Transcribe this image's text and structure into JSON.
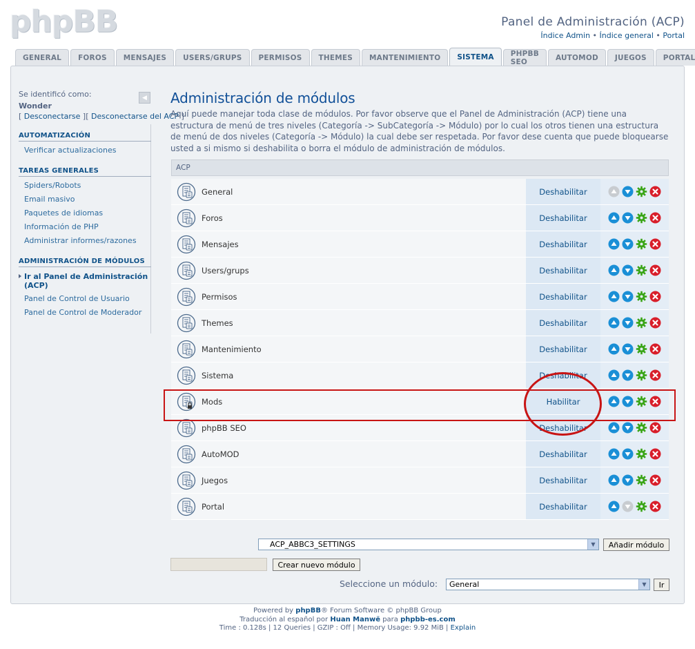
{
  "logo": {
    "text": "phpBB"
  },
  "header": {
    "title": "Panel de Administración (ACP)",
    "links": [
      "Índice Admin",
      "Índice general",
      "Portal"
    ],
    "separator": " • "
  },
  "tabs": [
    {
      "label": "GENERAL",
      "active": false
    },
    {
      "label": "FOROS",
      "active": false
    },
    {
      "label": "MENSAJES",
      "active": false
    },
    {
      "label": "USERS/GRUPS",
      "active": false
    },
    {
      "label": "PERMISOS",
      "active": false
    },
    {
      "label": "THEMES",
      "active": false
    },
    {
      "label": "MANTENIMIENTO",
      "active": false
    },
    {
      "label": "SISTEMA",
      "active": true
    },
    {
      "label": "PHPBB SEO",
      "active": false
    },
    {
      "label": "AUTOMOD",
      "active": false
    },
    {
      "label": "JUEGOS",
      "active": false
    },
    {
      "label": "PORTAL",
      "active": false
    }
  ],
  "sidebar": {
    "identified_as": "Se identificó como:",
    "username": "Wonder",
    "logout_open": "[ ",
    "logout_1": "Desconectarse",
    "logout_mid": " ][ ",
    "logout_2": "Desconectarse del ACP",
    "logout_close": " ]",
    "sections": [
      {
        "heading": "AUTOMATIZACIÓN",
        "items": [
          "Verificar actualizaciones"
        ]
      },
      {
        "heading": "TAREAS GENERALES",
        "items": [
          "Spiders/Robots",
          "Email masivo",
          "Paquetes de idiomas",
          "Información de PHP",
          "Administrar informes/razones"
        ]
      },
      {
        "heading": "ADMINISTRACIÓN DE MÓDULOS",
        "active_item": "Ir al Panel de Administración (ACP)",
        "items": [
          "Panel de Control de Usuario",
          "Panel de Control de Moderador"
        ]
      }
    ]
  },
  "main": {
    "title": "Administración de módulos",
    "description": "Aquí puede manejar toda clase de módulos. Por favor observe que el Panel de Administración (ACP) tiene una estructura de menú de tres niveles (Categoría -> SubCategoría -> Módulo) por lo cual los otros tienen una estructura de menú de dos niveles (Categoría -> Módulo) la cual debe ser respetada. Por favor dese cuenta que puede bloquearse usted a si mismo si deshabilita o borra el módulo de administración de módulos.",
    "table_header": "ACP",
    "modules": [
      {
        "name": "General",
        "action": "Deshabilitar",
        "up_enabled": false,
        "down_enabled": true,
        "locked": false
      },
      {
        "name": "Foros",
        "action": "Deshabilitar",
        "up_enabled": true,
        "down_enabled": true,
        "locked": false
      },
      {
        "name": "Mensajes",
        "action": "Deshabilitar",
        "up_enabled": true,
        "down_enabled": true,
        "locked": false
      },
      {
        "name": "Users/grups",
        "action": "Deshabilitar",
        "up_enabled": true,
        "down_enabled": true,
        "locked": false
      },
      {
        "name": "Permisos",
        "action": "Deshabilitar",
        "up_enabled": true,
        "down_enabled": true,
        "locked": false
      },
      {
        "name": "Themes",
        "action": "Deshabilitar",
        "up_enabled": true,
        "down_enabled": true,
        "locked": false
      },
      {
        "name": "Mantenimiento",
        "action": "Deshabilitar",
        "up_enabled": true,
        "down_enabled": true,
        "locked": false
      },
      {
        "name": "Sistema",
        "action": "Deshabilitar",
        "up_enabled": true,
        "down_enabled": true,
        "locked": false
      },
      {
        "name": "Mods",
        "action": "Habilitar",
        "up_enabled": true,
        "down_enabled": true,
        "locked": true
      },
      {
        "name": "phpBB SEO",
        "action": "Deshabilitar",
        "up_enabled": true,
        "down_enabled": true,
        "locked": false
      },
      {
        "name": "AutoMOD",
        "action": "Deshabilitar",
        "up_enabled": true,
        "down_enabled": true,
        "locked": false
      },
      {
        "name": "Juegos",
        "action": "Deshabilitar",
        "up_enabled": true,
        "down_enabled": true,
        "locked": false
      },
      {
        "name": "Portal",
        "action": "Deshabilitar",
        "up_enabled": true,
        "down_enabled": false,
        "locked": false
      }
    ],
    "add_select_value": "ACP_ABBC3_SETTINGS",
    "add_button": "Añadir módulo",
    "create_input_value": "",
    "create_button": "Crear nuevo módulo",
    "select_label": "Seleccione un módulo:",
    "select_value": "General",
    "go_button": "Ir"
  },
  "footer": {
    "line1_a": "Powered by ",
    "line1_link": "phpBB",
    "line1_b": "® Forum Software © phpBB Group",
    "line2_a": "Traducción al español por ",
    "line2_link1": "Huan Manwë",
    "line2_b": " para ",
    "line2_link2": "phpbb-es.com",
    "line3_a": "Time : 0.128s | 12 Queries | GZIP : Off | Memory Usage: 9.92 MiB | ",
    "line3_link": "Explain"
  },
  "colors": {
    "accent": "#105289",
    "highlight": "#c81414",
    "up_down_enabled": "#1a8fd6",
    "disabled": "#c8ccd0",
    "edit": "#3aa517",
    "delete": "#d81e2a"
  }
}
